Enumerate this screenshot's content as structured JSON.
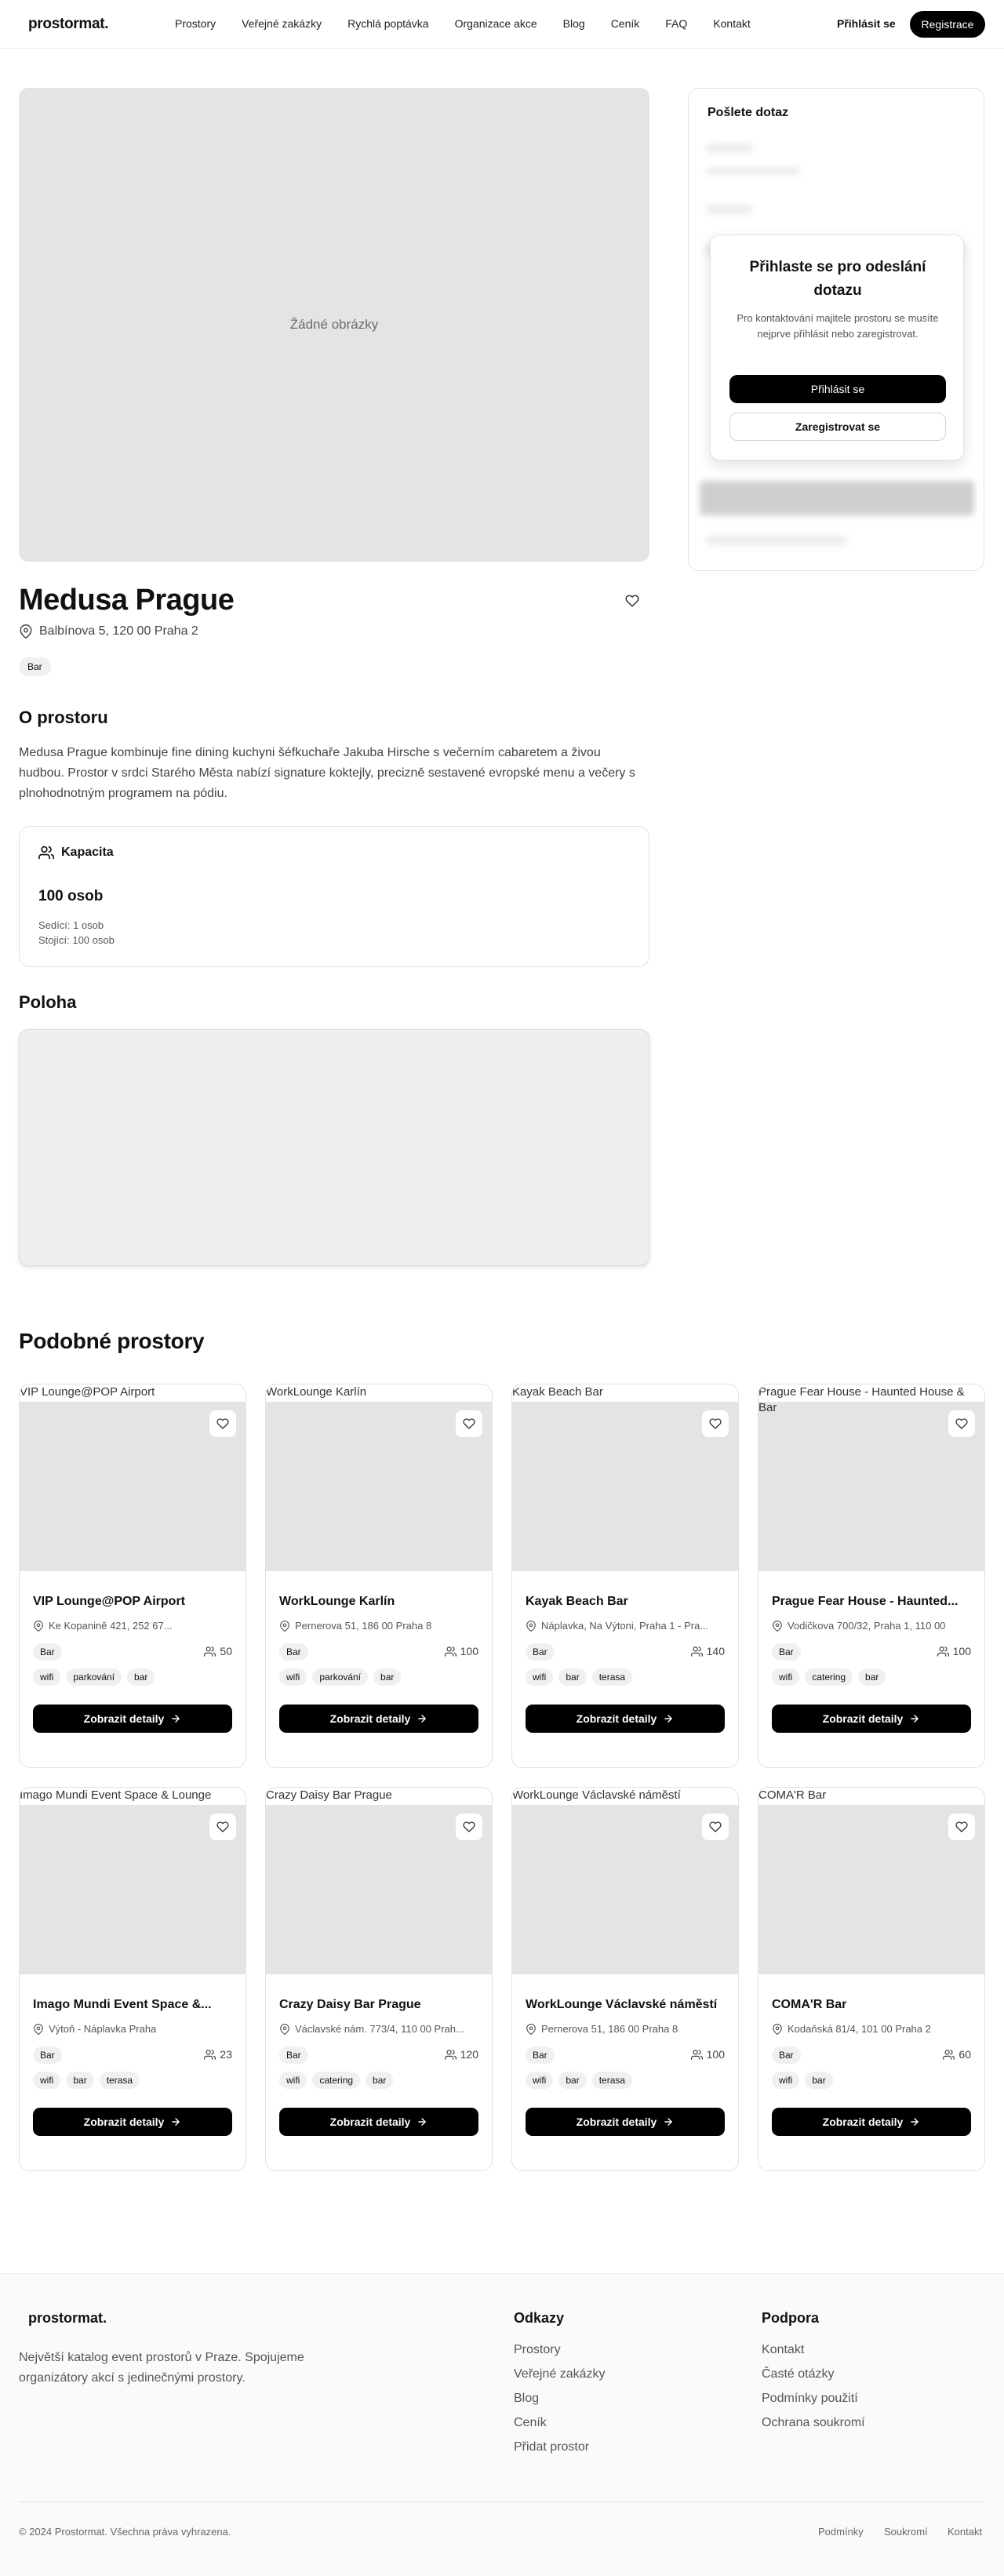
{
  "header": {
    "logo": "prostormat.",
    "nav": [
      "Prostory",
      "Veřejné zakázky",
      "Rychlá poptávka",
      "Organizace akce",
      "Blog",
      "Ceník",
      "FAQ",
      "Kontakt"
    ],
    "login": "Přihlásit se",
    "register": "Registrace"
  },
  "gallery": {
    "empty_text": "Žádné obrázky"
  },
  "venue": {
    "name": "Medusa Prague",
    "address": "Balbínova 5, 120 00 Praha 2",
    "category": "Bar",
    "about_heading": "O prostoru",
    "about_text": "Medusa Prague kombinuje fine dining kuchyni šéfkuchaře Jakuba Hirsche s večerním cabaretem a živou hudbou. Prostor v srdci Starého Města nabízí signature koktejly, precizně sestavené evropské menu a večery s plnohodnotným programem na pódiu.",
    "capacity_heading": "Kapacita",
    "capacity_total": "100 osob",
    "capacity_seated": "Sedící: 1 osob",
    "capacity_standing": "Stojící: 100 osob",
    "location_heading": "Poloha"
  },
  "contact": {
    "title": "Pošlete dotaz",
    "modal_title": "Přihlaste se pro odeslání dotazu",
    "modal_text": "Pro kontaktování majitele prostoru se musíte nejprve přihlásit nebo zaregistrovat.",
    "login_button": "Přihlásit se",
    "register_button": "Zaregistrovat se"
  },
  "similar": {
    "heading": "Podobné prostory",
    "button_label": "Zobrazit detaily",
    "cards": [
      {
        "alt": "VIP Lounge@POP Airport",
        "name": "VIP Lounge@POP Airport",
        "address": "Ke Kopanině 421, 252 67...",
        "category": "Bar",
        "capacity": "50",
        "tags": [
          "wifi",
          "parkování",
          "bar"
        ]
      },
      {
        "alt": "WorkLounge Karlín",
        "name": "WorkLounge Karlín",
        "address": "Pernerova 51, 186 00 Praha 8",
        "category": "Bar",
        "capacity": "100",
        "tags": [
          "wifi",
          "parkování",
          "bar"
        ]
      },
      {
        "alt": "Kayak Beach Bar",
        "name": "Kayak Beach Bar",
        "address": "Náplavka, Na Výtoni, Praha 1 - Pra...",
        "category": "Bar",
        "capacity": "140",
        "tags": [
          "wifi",
          "bar",
          "terasa"
        ]
      },
      {
        "alt": "Prague Fear House - Haunted House & Bar",
        "name": "Prague Fear House - Haunted...",
        "address": "Vodičkova 700/32, Praha 1, 110 00",
        "category": "Bar",
        "capacity": "100",
        "tags": [
          "wifi",
          "catering",
          "bar"
        ]
      },
      {
        "alt": "Imago Mundi Event Space & Lounge",
        "name": "Imago Mundi Event Space &...",
        "address": "Výtoň - Náplavka Praha",
        "category": "Bar",
        "capacity": "23",
        "tags": [
          "wifi",
          "bar",
          "terasa"
        ]
      },
      {
        "alt": "Crazy Daisy Bar Prague",
        "name": "Crazy Daisy Bar Prague",
        "address": "Václavské nám. 773/4, 110 00 Prah...",
        "category": "Bar",
        "capacity": "120",
        "tags": [
          "wifi",
          "catering",
          "bar"
        ]
      },
      {
        "alt": "WorkLounge Václavské náměstí",
        "name": "WorkLounge Václavské náměstí",
        "address": "Pernerova 51, 186 00 Praha 8",
        "category": "Bar",
        "capacity": "100",
        "tags": [
          "wifi",
          "bar",
          "terasa"
        ]
      },
      {
        "alt": "COMA'R Bar",
        "name": "COMA'R Bar",
        "address": "Kodaňská 81/4, 101 00 Praha 2",
        "category": "Bar",
        "capacity": "60",
        "tags": [
          "wifi",
          "bar"
        ]
      }
    ]
  },
  "footer": {
    "logo": "prostormat.",
    "description": "Největší katalog event prostorů v Praze. Spojujeme organizátory akcí s jedinečnými prostory.",
    "links_heading": "Odkazy",
    "links": [
      "Prostory",
      "Veřejné zakázky",
      "Blog",
      "Ceník",
      "Přidat prostor"
    ],
    "support_heading": "Podpora",
    "support": [
      "Kontakt",
      "Časté otázky",
      "Podmínky použití",
      "Ochrana soukromí"
    ],
    "copyright": "© 2024 Prostormat. Všechna práva vyhrazena.",
    "bottom_links": [
      "Podmínky",
      "Soukromí",
      "Kontakt"
    ]
  }
}
